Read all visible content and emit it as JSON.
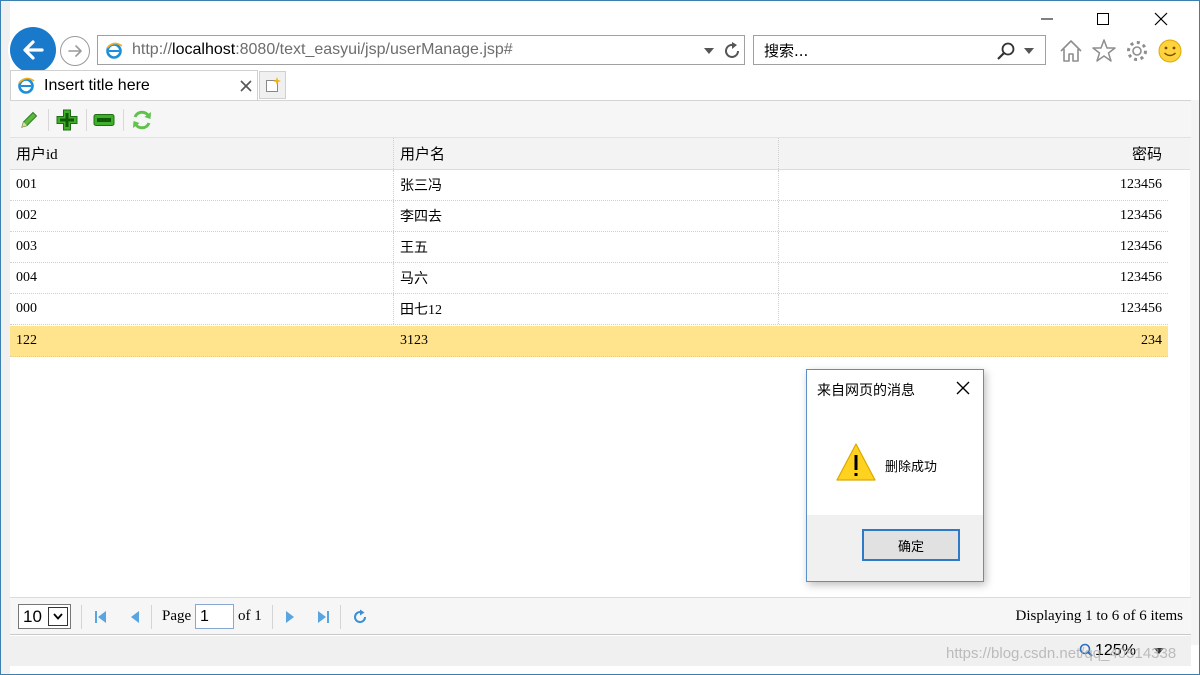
{
  "browser": {
    "url_scheme": "http://",
    "url_host": "localhost",
    "url_rest": ":8080/text_easyui/jsp/userManage.jsp#",
    "search_placeholder": "搜索...",
    "tab_title": "Insert title here",
    "zoom_level": "125%"
  },
  "grid": {
    "columns": [
      "用户id",
      "用户名",
      "密码"
    ],
    "rows": [
      {
        "id": "001",
        "name": "张三冯",
        "password": "123456",
        "selected": false
      },
      {
        "id": "002",
        "name": "李四去",
        "password": "123456",
        "selected": false
      },
      {
        "id": "003",
        "name": "王五",
        "password": "123456",
        "selected": false
      },
      {
        "id": "004",
        "name": "马六",
        "password": "123456",
        "selected": false
      },
      {
        "id": "000",
        "name": "田七12",
        "password": "123456",
        "selected": false
      },
      {
        "id": "122",
        "name": "3123",
        "password": "234",
        "selected": true
      }
    ]
  },
  "pager": {
    "page_size": "10",
    "page_label": "Page",
    "page_value": "1",
    "of_label": "of 1",
    "display_info": "Displaying 1 to 6 of 6 items"
  },
  "dialog": {
    "title": "来自网页的消息",
    "message": "删除成功",
    "ok_label": "确定"
  },
  "watermark": "https://blog.csdn.net/qq_40514338",
  "colors": {
    "selected_row": "#ffe48d",
    "accent": "#1979ca"
  }
}
